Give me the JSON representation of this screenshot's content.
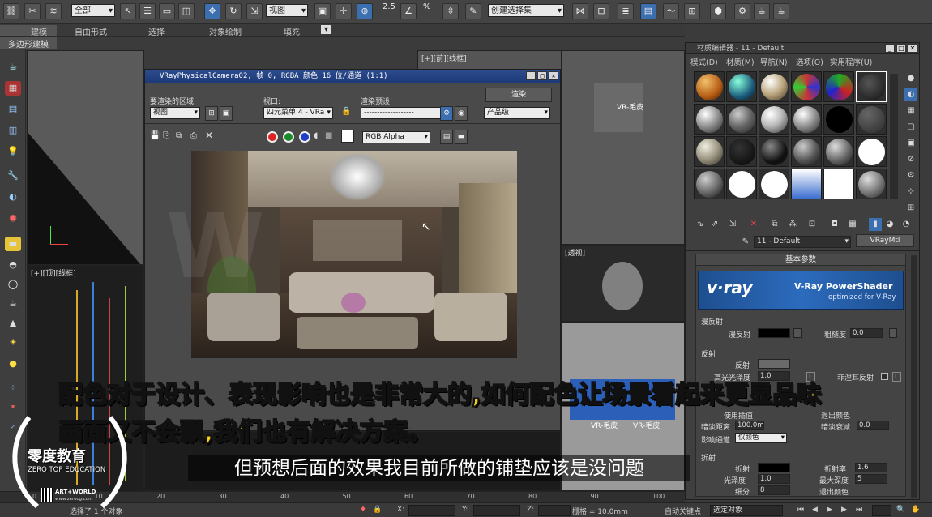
{
  "toolbar": {
    "selection_filter": "全部",
    "view_dropdown": "视图",
    "snap_angle": "2.5",
    "percent_snap": "%",
    "named_selection": "创建选择集"
  },
  "ribbon": {
    "tabs": [
      "建模",
      "自由形式",
      "选择",
      "对象绘制",
      "填充"
    ],
    "sub_tab": "多边形建模"
  },
  "viewports": {
    "top_left_label": "[+][顶][线框]",
    "top_center_label": "[+][前][线框]",
    "bottom_left_label": "[+][顶][线框]",
    "right_labels": [
      "VR-毛皮",
      "VR-毛皮",
      "VR-毛皮"
    ],
    "small_label": "[透视]"
  },
  "render_window": {
    "title": "VRayPhysicalCamera02, 帧 0, RGBA 颜色 16 位/通道 (1:1)",
    "area_label": "要渲染的区域:",
    "area_value": "视图",
    "viewport_label": "视口:",
    "viewport_value": "四元菜单 4 - VRa",
    "preset_label": "渲染预设:",
    "preset_value": "-------------------",
    "render_button": "渲染",
    "quality_value": "产品级",
    "channel_value": "RGB Alpha"
  },
  "material_editor": {
    "title": "材质编辑器 - 11 - Default",
    "menu": [
      "模式(D)",
      "材质(M)",
      "导航(N)",
      "选项(O)",
      "实用程序(U)"
    ],
    "material_name": "11 - Default",
    "material_type": "VRayMtl",
    "rollout_title": "基本参数",
    "vray_banner": "V-Ray PowerShader",
    "vray_banner_sub": "optimized for V-Ray",
    "vray_logo": "v·ray",
    "diffuse_group": "漫反射",
    "diffuse_label": "漫反射",
    "roughness_label": "粗糙度",
    "roughness_value": "0.0",
    "reflect_group": "反射",
    "reflect_label": "反射",
    "hilight_gloss_label": "高光光泽度",
    "hilight_gloss_value": "1.0",
    "fresnel_label": "菲涅耳反射",
    "fresnel_lock": "L",
    "hilight_lock": "L",
    "use_interp_label": "使用插值",
    "exit_color_label": "退出颜色",
    "dim_distance_label": "暗淡距离",
    "dim_distance_value": "100.0m",
    "dim_falloff_label": "暗淡衰减",
    "dim_falloff_value": "0.0",
    "affect_channels_label": "影响通道",
    "affect_channels_value": "仅颜色",
    "refract_group": "折射",
    "refract_label": "折射",
    "ior_label": "折射率",
    "ior_value": "1.6",
    "gloss_label": "光泽度",
    "gloss_value": "1.0",
    "max_depth_label": "最大深度",
    "max_depth_value": "5",
    "subdivs_label": "细分",
    "subdivs_value": "8",
    "exit_color2_label": "退出颜色"
  },
  "subtitles": {
    "yellow_line1": "配色对于设计、表现影响也是非常大的,如何配色让场景看起来更显品味",
    "yellow_line2": "画面又不会飘,我们也有解决方案。",
    "white_line": "但预想后面的效果我目前所做的铺垫应该是没问题"
  },
  "logo": {
    "name_cn": "零度教育",
    "name_en": "ZERO TOP EDUCATION",
    "brand": "ART+WORLD",
    "site": "www.zerocg.com"
  },
  "statusbar": {
    "selection_text": "选择了 1 个对象",
    "x_label": "X:",
    "y_label": "Y:",
    "z_label": "Z:",
    "grid_text": "栅格 = 10.0mm",
    "auto_key": "自动关键点",
    "selected_object": "选定对象"
  },
  "timeline": {
    "ticks": [
      "0",
      "10",
      "20",
      "30",
      "40",
      "50",
      "60",
      "70",
      "80",
      "90",
      "100"
    ]
  },
  "colors": {
    "subtitle_yellow": "#f5d21a",
    "titlebar_blue": "#1d3a78",
    "vray_blue": "#1e4f8f"
  }
}
